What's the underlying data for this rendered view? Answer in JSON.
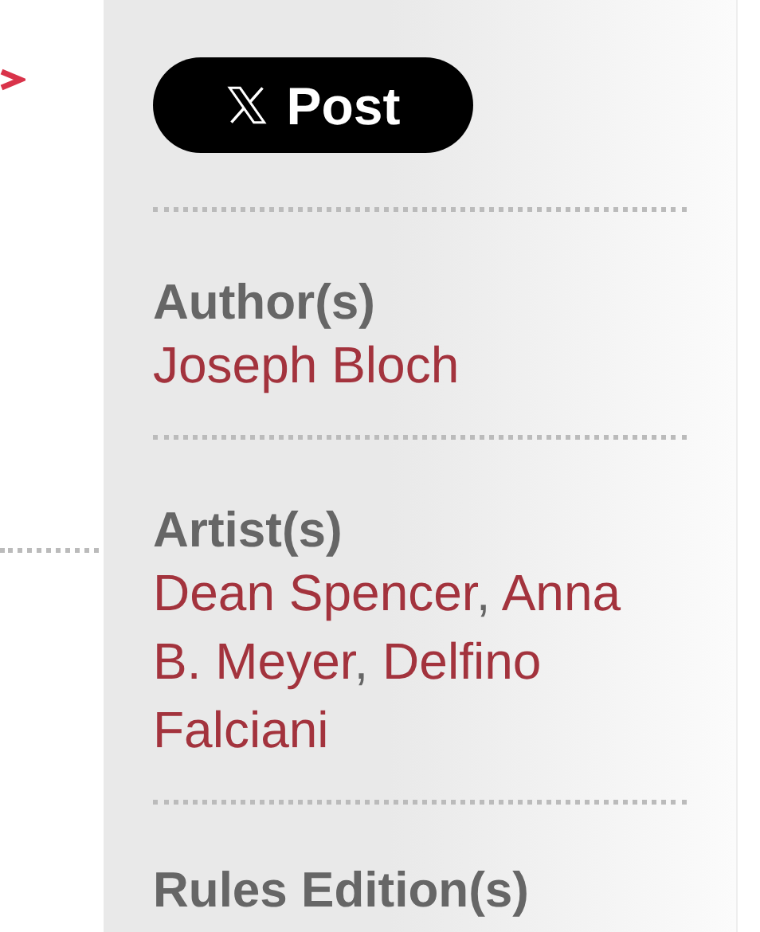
{
  "share_button": {
    "label": "Post"
  },
  "sections": [
    {
      "label": "Author(s)",
      "names": [
        "Joseph Bloch"
      ]
    },
    {
      "label": "Artist(s)",
      "separator": ", ",
      "names": [
        "Dean Spencer",
        "Anna B. Meyer",
        "Delfino Falciani"
      ]
    },
    {
      "label": "Rules Edition(s)"
    }
  ]
}
